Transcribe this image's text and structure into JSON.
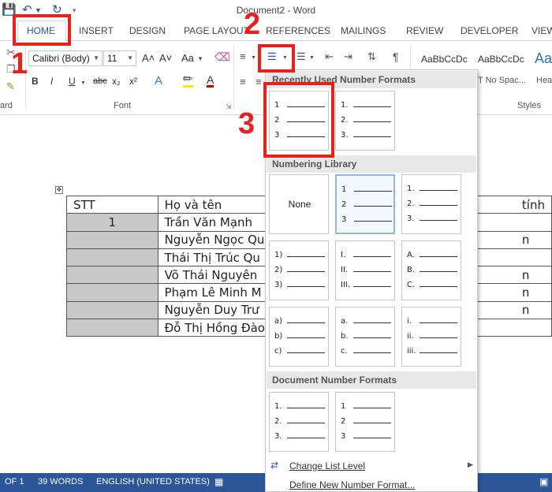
{
  "app": {
    "title": "Document2 - Word"
  },
  "tabs": [
    "HOME",
    "INSERT",
    "DESIGN",
    "PAGE LAYOUT",
    "REFERENCES",
    "MAILINGS",
    "REVIEW",
    "DEVELOPER",
    "VIEW"
  ],
  "ribbon": {
    "font_name": "Calibri (Body)",
    "font_size": "11",
    "group_clipboard": "ard",
    "group_font": "Font",
    "group_styles": "Styles",
    "style_tiles": [
      "AaBbCcDc",
      "AaBbCcDc",
      "Aa"
    ],
    "style_names": [
      "T No Spac...",
      "Hea"
    ],
    "format_buttons": [
      "B",
      "I",
      "U",
      "abc",
      "x₂",
      "x²",
      "A",
      "A"
    ],
    "grow_font": "A˄",
    "shrink_font": "A˅",
    "change_case": "Aa",
    "pilcrow": "¶"
  },
  "annotations": [
    "1",
    "2",
    "3"
  ],
  "table": {
    "header": [
      "STT",
      "Họ và tên",
      "tính"
    ],
    "rows": [
      {
        "stt": "1",
        "name": "Trần Văn Mạnh"
      },
      {
        "stt": "",
        "name": "Nguyễn Ngọc Qu"
      },
      {
        "stt": "",
        "name": "Thái Thị Trúc Qu"
      },
      {
        "stt": "",
        "name": "Võ Thái Nguyên"
      },
      {
        "stt": "",
        "name": "Phạm Lê Minh M"
      },
      {
        "stt": "",
        "name": "Nguyễn Duy Trư"
      },
      {
        "stt": "",
        "name": "Đỗ Thị Hồng Đào"
      }
    ],
    "gender_partial": [
      "",
      "n",
      "",
      "n",
      "n",
      "n",
      ""
    ]
  },
  "menu": {
    "recent_title": "Recently Used Number Formats",
    "library_title": "Numbering Library",
    "document_title": "Document Number Formats",
    "none_label": "None",
    "change_level": "Change List Level",
    "define_new": "Define New Number Format...",
    "recent": [
      [
        "1",
        "2",
        "3"
      ],
      [
        "1.",
        "2.",
        "3."
      ]
    ],
    "library": [
      [
        "1",
        "2",
        "3"
      ],
      [
        "1.",
        "2.",
        "3."
      ],
      [
        "1)",
        "2)",
        "3)"
      ],
      [
        "I.",
        "II.",
        "III."
      ],
      [
        "A.",
        "B.",
        "C."
      ],
      [
        "a)",
        "b)",
        "c)"
      ],
      [
        "a.",
        "b.",
        "c."
      ],
      [
        "i.",
        "ii.",
        "iii."
      ]
    ],
    "document": [
      [
        "1.",
        "2.",
        "3."
      ],
      [
        "1",
        "2",
        "3"
      ]
    ]
  },
  "status": {
    "page": "OF 1",
    "words": "39 WORDS",
    "language": "ENGLISH (UNITED STATES)"
  },
  "colors": {
    "accent": "#2b579a",
    "annotation": "#e8211c"
  }
}
